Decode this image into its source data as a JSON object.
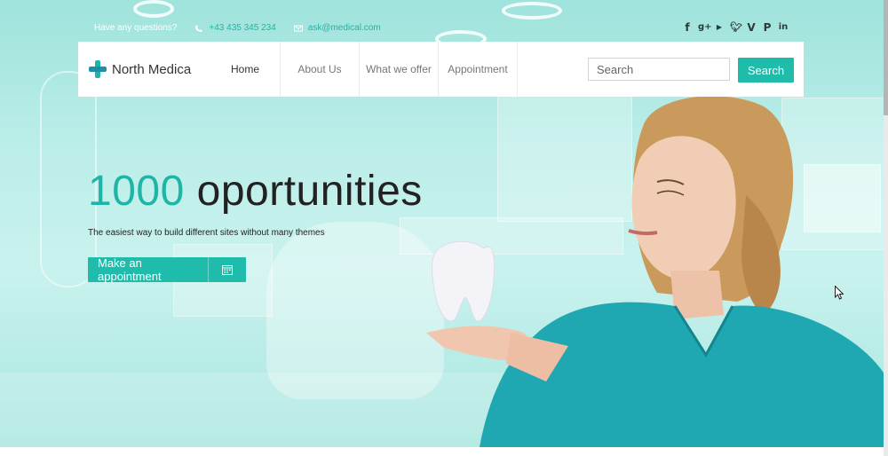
{
  "topbar": {
    "question": "Have any questions?",
    "phone": "+43 435 345 234",
    "email": "ask@medical.com",
    "social_icons": [
      "facebook-icon",
      "google-plus-icon",
      "youtube-icon",
      "twitter-icon",
      "vimeo-icon",
      "pinterest-icon",
      "linkedin-icon"
    ]
  },
  "nav": {
    "brand": "North Medica",
    "items": [
      {
        "label": "Home",
        "active": true
      },
      {
        "label": "About Us",
        "active": false
      },
      {
        "label": "What we offer",
        "active": false
      },
      {
        "label": "Appointment",
        "active": false
      }
    ],
    "search_placeholder": "Search",
    "search_button": "Search"
  },
  "hero": {
    "headline_number": "1000",
    "headline_text": "oportunities",
    "subtitle": "The easiest way to build different sites without many themes",
    "cta_label": "Make an appointment"
  },
  "colors": {
    "accent": "#1fbcab",
    "background": "#b9ede8",
    "text": "#222222"
  }
}
